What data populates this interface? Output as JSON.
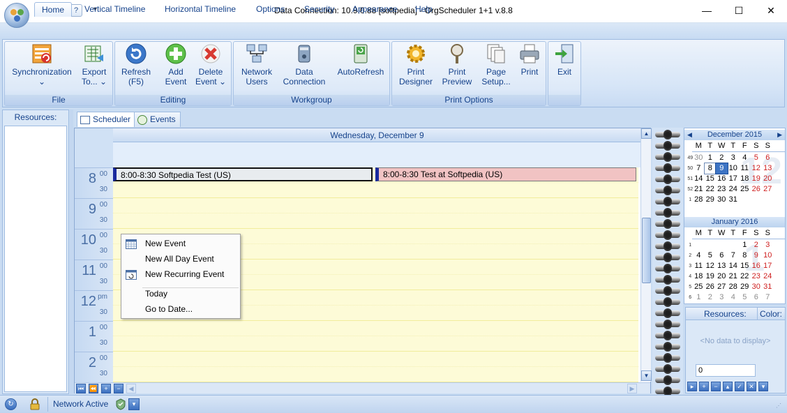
{
  "window": {
    "title": "Data Connection: 10.9.0.88 [softpedia] - OrgScheduler 1+1 v.8.8",
    "minimize": "—",
    "maximize": "☐",
    "close": "✕"
  },
  "qat": {
    "overflow": "▾"
  },
  "tabs": [
    "Home",
    "Vertical Timeline",
    "Horizontal Timeline",
    "Options",
    "Security",
    "Appearance",
    "Help"
  ],
  "ribbon": {
    "groups": {
      "file": "File",
      "editing": "Editing",
      "workgroup": "Workgroup",
      "print_options": "Print Options"
    },
    "buttons": {
      "synchronization": {
        "line1": "Synchronization",
        "line2": "⌄"
      },
      "export": {
        "line1": "Export",
        "line2": "To... ⌄"
      },
      "refresh": {
        "line1": "Refresh",
        "line2": "(F5)"
      },
      "add_event": {
        "line1": "Add",
        "line2": "Event"
      },
      "delete_event": {
        "line1": "Delete",
        "line2": "Event ⌄"
      },
      "network_users": {
        "line1": "Network",
        "line2": "Users"
      },
      "data_connection": {
        "line1": "Data",
        "line2": "Connection"
      },
      "autorefresh": {
        "line1": "AutoRefresh",
        "line2": ""
      },
      "print_designer": {
        "line1": "Print",
        "line2": "Designer"
      },
      "print_preview": {
        "line1": "Print",
        "line2": "Preview"
      },
      "page_setup": {
        "line1": "Page",
        "line2": "Setup..."
      },
      "print": {
        "line1": "Print",
        "line2": ""
      },
      "exit": {
        "line1": "Exit",
        "line2": ""
      }
    }
  },
  "resources_panel": {
    "title": "Resources:"
  },
  "scheduler_tabs": {
    "scheduler": "Scheduler",
    "events": "Events"
  },
  "day_header": "Wednesday, December 9",
  "hours": [
    {
      "h": "8",
      "m": "00",
      "m30": "30"
    },
    {
      "h": "9",
      "m": "00",
      "m30": "30"
    },
    {
      "h": "10",
      "m": "00",
      "m30": "30"
    },
    {
      "h": "11",
      "m": "00",
      "m30": "30"
    },
    {
      "h": "12",
      "m": "pm",
      "m30": "30"
    },
    {
      "h": "1",
      "m": "00",
      "m30": "30"
    },
    {
      "h": "2",
      "m": "00",
      "m30": "30"
    }
  ],
  "events": [
    {
      "text": "8:00-8:30 Softpedia Test (US)",
      "color": "#e8ecef"
    },
    {
      "text": "8:00-8:30 Test at Softpedia (US)",
      "color": "#f1c3c3"
    }
  ],
  "context_menu": {
    "new_event": "New Event",
    "new_all_day_event": "New All Day Event",
    "new_recurring_event": "New Recurring Event",
    "today": "Today",
    "go_to_date": "Go to Date..."
  },
  "calendar": {
    "dow": [
      "M",
      "T",
      "W",
      "T",
      "F",
      "S",
      "S"
    ],
    "prev": "◀",
    "next": "▶",
    "december": {
      "title": "December 2015",
      "big": "12",
      "weeks": [
        {
          "wn": "49",
          "days": [
            "30",
            "1",
            "2",
            "3",
            "4",
            "5",
            "6"
          ]
        },
        {
          "wn": "50",
          "days": [
            "7",
            "8",
            "9",
            "10",
            "11",
            "12",
            "13"
          ]
        },
        {
          "wn": "51",
          "days": [
            "14",
            "15",
            "16",
            "17",
            "18",
            "19",
            "20"
          ]
        },
        {
          "wn": "52",
          "days": [
            "21",
            "22",
            "23",
            "24",
            "25",
            "26",
            "27"
          ]
        },
        {
          "wn": "1",
          "days": [
            "28",
            "29",
            "30",
            "31",
            "",
            "",
            ""
          ]
        }
      ]
    },
    "january": {
      "title": "January 2016",
      "big": "1",
      "weeks": [
        {
          "wn": "1",
          "days": [
            "",
            "",
            "",
            "",
            "1",
            "2",
            "3"
          ]
        },
        {
          "wn": "2",
          "days": [
            "4",
            "5",
            "6",
            "7",
            "8",
            "9",
            "10"
          ]
        },
        {
          "wn": "3",
          "days": [
            "11",
            "12",
            "13",
            "14",
            "15",
            "16",
            "17"
          ]
        },
        {
          "wn": "4",
          "days": [
            "18",
            "19",
            "20",
            "21",
            "22",
            "23",
            "24"
          ]
        },
        {
          "wn": "5",
          "days": [
            "25",
            "26",
            "27",
            "28",
            "29",
            "30",
            "31"
          ]
        },
        {
          "wn": "6",
          "days": [
            "1",
            "2",
            "3",
            "4",
            "5",
            "6",
            "7"
          ]
        }
      ]
    }
  },
  "resource_color_panel": {
    "resources_header": "Resources:",
    "color_header": "Color:",
    "empty_text": "<No data to display>",
    "input_value": "0"
  },
  "statusbar": {
    "network": "Network Active"
  }
}
